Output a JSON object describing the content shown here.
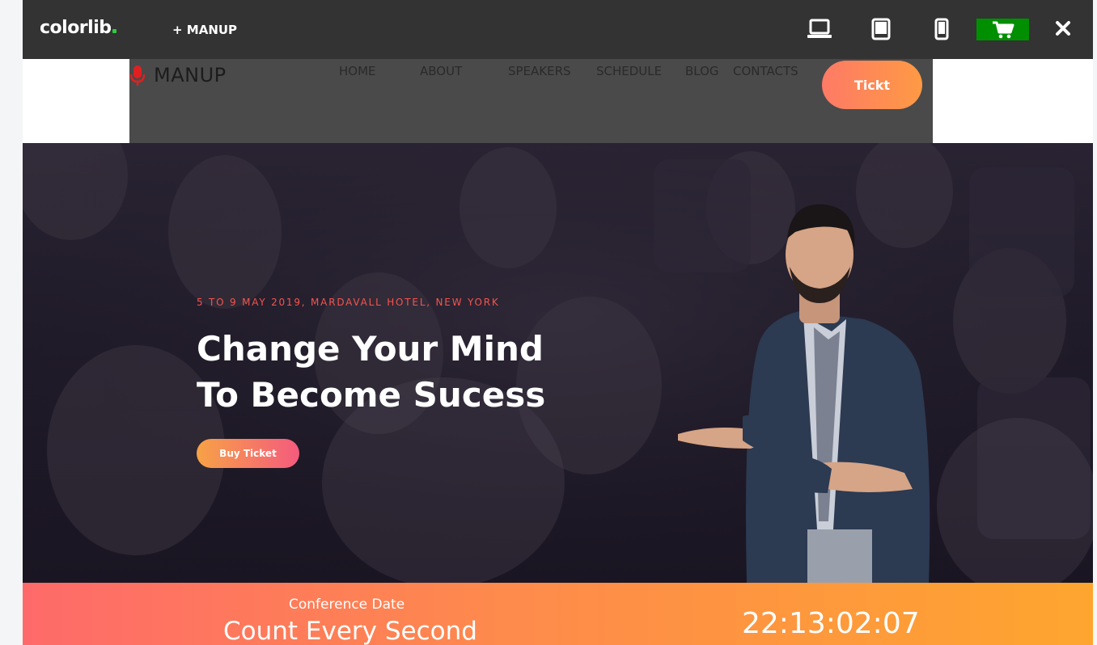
{
  "topbar": {
    "brand": "colorlib",
    "theme_link": "+ MANUP",
    "icons": [
      "laptop-icon",
      "tablet-icon",
      "phone-icon",
      "cart-icon",
      "close-icon"
    ],
    "colors": {
      "bar": "#333333",
      "cart": "#008f00",
      "brand_dot": "#2ecc40"
    }
  },
  "site": {
    "logo": "MANUP",
    "logo_icon": "microphone-icon",
    "nav": [
      {
        "label": "HOME"
      },
      {
        "label": "ABOUT"
      },
      {
        "label": "SPEAKERS"
      },
      {
        "label": "SCHEDULE"
      },
      {
        "label": "BLOG"
      },
      {
        "label": "CONTACTS"
      }
    ],
    "ticket_button": "Tickt",
    "colors": {
      "accent": "#f5544d",
      "button_from": "#fe7a66",
      "button_to": "#fe9a44"
    }
  },
  "hero": {
    "date": "5 TO 9 MAY 2019, MARDAVALL HOTEL, NEW YORK",
    "title_line1": "Change Your Mind",
    "title_line2": "To Become Sucess",
    "buy_button": "Buy Ticket"
  },
  "countdown": {
    "label": "Conference Date",
    "title": "Count Every Second",
    "timer": "22:13:02:07"
  }
}
